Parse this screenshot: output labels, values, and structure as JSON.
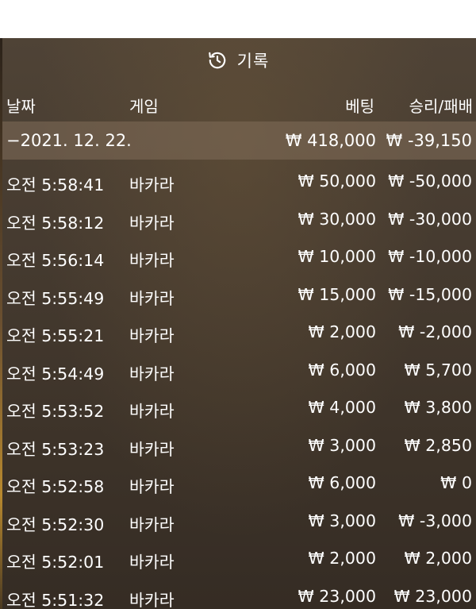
{
  "header": {
    "title": "기록",
    "icon": "history-icon"
  },
  "columns": {
    "date": "날짜",
    "game": "게임",
    "bet": "베팅",
    "result": "승리/패배"
  },
  "group": {
    "date": "−2021. 12. 22.",
    "bet_total": "₩ 418,000",
    "result_total": "₩ -39,150"
  },
  "rows": [
    {
      "time": "오전 5:58:41",
      "game": "바카라",
      "bet": "₩ 50,000",
      "result": "₩ -50,000"
    },
    {
      "time": "오전 5:58:12",
      "game": "바카라",
      "bet": "₩ 30,000",
      "result": "₩ -30,000"
    },
    {
      "time": "오전 5:56:14",
      "game": "바카라",
      "bet": "₩ 10,000",
      "result": "₩ -10,000"
    },
    {
      "time": "오전 5:55:49",
      "game": "바카라",
      "bet": "₩ 15,000",
      "result": "₩ -15,000"
    },
    {
      "time": "오전 5:55:21",
      "game": "바카라",
      "bet": "₩ 2,000",
      "result": "₩ -2,000"
    },
    {
      "time": "오전 5:54:49",
      "game": "바카라",
      "bet": "₩ 6,000",
      "result": "₩ 5,700"
    },
    {
      "time": "오전 5:53:52",
      "game": "바카라",
      "bet": "₩ 4,000",
      "result": "₩ 3,800"
    },
    {
      "time": "오전 5:53:23",
      "game": "바카라",
      "bet": "₩ 3,000",
      "result": "₩ 2,850"
    },
    {
      "time": "오전 5:52:58",
      "game": "바카라",
      "bet": "₩ 6,000",
      "result": "₩ 0"
    },
    {
      "time": "오전 5:52:30",
      "game": "바카라",
      "bet": "₩ 3,000",
      "result": "₩ -3,000"
    },
    {
      "time": "오전 5:52:01",
      "game": "바카라",
      "bet": "₩ 2,000",
      "result": "₩ 2,000"
    },
    {
      "time": "오전 5:51:32",
      "game": "바카라",
      "bet": "₩ 23,000",
      "result": "₩ 23,000"
    }
  ]
}
